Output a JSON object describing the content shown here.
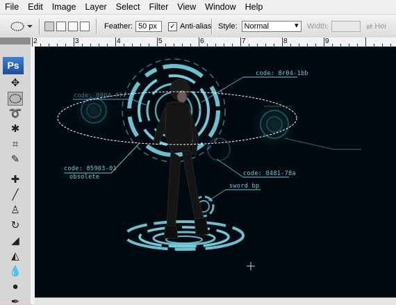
{
  "menu": [
    "File",
    "Edit",
    "Image",
    "Layer",
    "Select",
    "Filter",
    "View",
    "Window",
    "Help"
  ],
  "options": {
    "feather_label": "Feather:",
    "feather_value": "50 px",
    "antialias_label": "Anti-alias",
    "antialias_checked": true,
    "style_label": "Style:",
    "style_value": "Normal",
    "width_label": "Width:",
    "width_value": "",
    "height_label": "Hei"
  },
  "toolbox": {
    "logo": "Ps",
    "tools": [
      "move-icon",
      "elliptical-marquee-icon",
      "lasso-icon",
      "magic-wand-icon",
      "crop-icon",
      "eyedropper-icon",
      "healing-brush-icon",
      "brush-icon",
      "clone-stamp-icon",
      "history-brush-icon",
      "eraser-icon",
      "paint-bucket-icon",
      "blur-icon",
      "dodge-icon",
      "pen-icon"
    ]
  },
  "ruler": {
    "top_numbers": [
      "2",
      "3",
      "4",
      "5",
      "6",
      "7",
      "8",
      "9"
    ]
  },
  "canvas": {
    "hud_labels": [
      "code: 8r04-1bb",
      "code: 0004-ff",
      "code: 85903-01",
      "obsolete",
      "code: 8481-78a",
      "sword bp"
    ],
    "colors": {
      "background": "#000a10",
      "hud": "#6fc9d8"
    }
  }
}
